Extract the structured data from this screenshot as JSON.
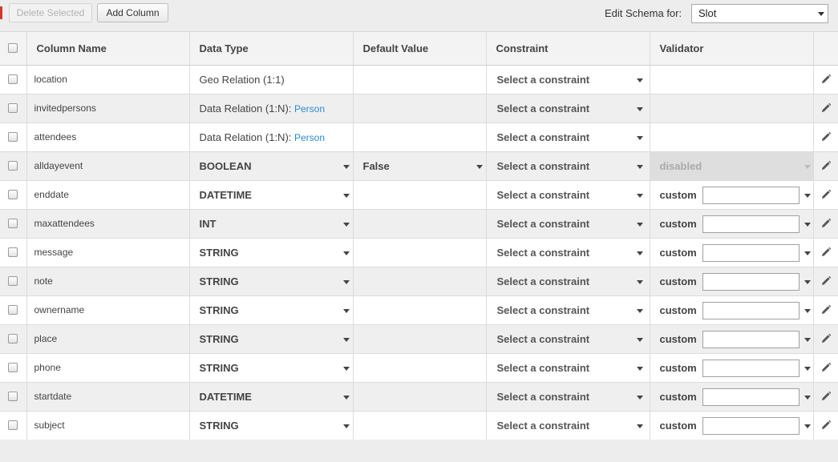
{
  "toolbar": {
    "delete_label": "Delete Selected",
    "add_label": "Add Column",
    "schema_label": "Edit Schema for:",
    "schema_value": "Slot"
  },
  "columns": {
    "name": "Column Name",
    "type": "Data Type",
    "default": "Default Value",
    "constraint": "Constraint",
    "validator": "Validator"
  },
  "rows": [
    {
      "name": "location",
      "type_prefix": "Geo Relation (1:1)",
      "type_link": "",
      "relation": true
    },
    {
      "name": "invitedpersons",
      "type_prefix": "Data Relation (1:N): ",
      "type_link": "Person",
      "relation": true
    },
    {
      "name": "attendees",
      "type_prefix": "Data Relation (1:N): ",
      "type_link": "Person",
      "relation": true
    },
    {
      "name": "alldayevent",
      "type": "BOOLEAN",
      "default": "False",
      "validator": "disabled"
    },
    {
      "name": "enddate",
      "type": "DATETIME",
      "validator": "custom"
    },
    {
      "name": "maxattendees",
      "type": "INT",
      "validator": "custom"
    },
    {
      "name": "message",
      "type": "STRING",
      "validator": "custom"
    },
    {
      "name": "note",
      "type": "STRING",
      "validator": "custom"
    },
    {
      "name": "ownername",
      "type": "STRING",
      "validator": "custom"
    },
    {
      "name": "place",
      "type": "STRING",
      "validator": "custom"
    },
    {
      "name": "phone",
      "type": "STRING",
      "validator": "custom"
    },
    {
      "name": "startdate",
      "type": "DATETIME",
      "validator": "custom"
    },
    {
      "name": "subject",
      "type": "STRING",
      "validator": "custom"
    }
  ],
  "constraint_placeholder": "Select a constraint",
  "icons": {
    "edit": "pencil-icon",
    "dropdown": "chevron-down-icon"
  },
  "colors": {
    "link": "#2a8bd4",
    "alt_row": "#efefef",
    "disabled": "#dedede"
  }
}
